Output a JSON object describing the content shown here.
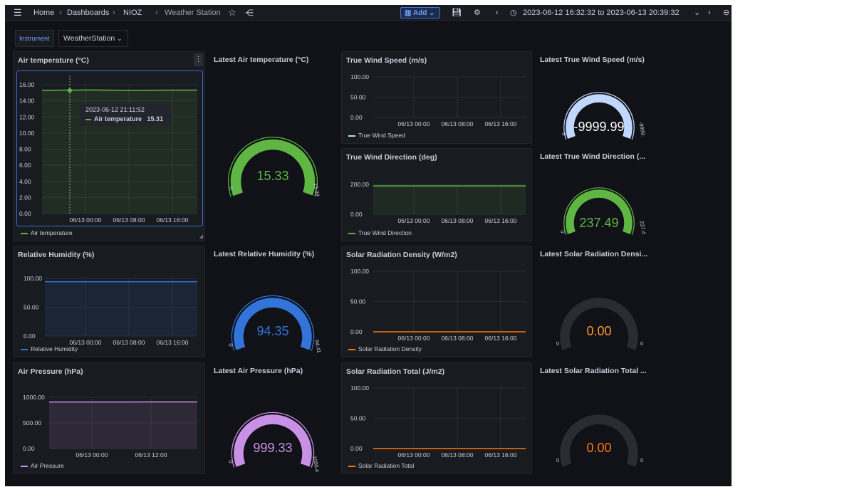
{
  "breadcrumb": {
    "home": "Home",
    "dashboards": "Dashboards",
    "folder": "NIOZ",
    "dashboard": "Weather Station"
  },
  "toolbar": {
    "add_label": "Add",
    "time_range": "2023-06-12 16:32:32 to 2023-06-13 20:39:32"
  },
  "variables": {
    "instrument_label": "Instrument",
    "instrument_value": "WeatherStation"
  },
  "colors": {
    "green": "#5fb643",
    "blue": "#3274d9",
    "purple": "#c891e6",
    "lightblue": "#c0d8ff",
    "orange": "#ff780a",
    "yellow": "#fade2a"
  },
  "panels": {
    "air_temp": {
      "title": "Air temperature (°C)",
      "yticks": [
        "16.00",
        "14.00",
        "12.00",
        "10.00",
        "8.00",
        "6.00",
        "4.00",
        "2.00",
        "0.00"
      ],
      "xticks": [
        "06/13 00:00",
        "06/13 08:00",
        "06/13 16:00"
      ],
      "legend": "Air temperature",
      "tooltip_time": "2023-06-12 21:11:52",
      "tooltip_series": "Air temperature",
      "tooltip_value": "15.31"
    },
    "latest_air_temp": {
      "title": "Latest Air temperature (°C)",
      "value": "15.33",
      "min": "0",
      "max": "15.39",
      "fraction": 0.996
    },
    "wind_speed": {
      "title": "True Wind Speed (m/s)",
      "yticks": [
        "100.00",
        "50.00",
        "0.00"
      ],
      "xticks": [
        "06/13 00:00",
        "06/13 08:00",
        "06/13 16:00"
      ],
      "legend": "True Wind Speed"
    },
    "latest_wind_speed": {
      "title": "Latest True Wind Speed (m/s)",
      "value": "-9999.99",
      "min": "0",
      "max": "-9999.",
      "fraction": 1.0
    },
    "wind_dir": {
      "title": "True Wind Direction (deg)",
      "yticks": [
        "200.00",
        "0.00"
      ],
      "xticks": [
        "06/13 00:00",
        "06/13 08:00",
        "06/13 16:00"
      ],
      "legend": "True Wind Direction"
    },
    "latest_wind_dir": {
      "title": "Latest True Wind Direction (...",
      "value": "237.49",
      "min": "0",
      "max": "237.4",
      "fraction": 1.0
    },
    "humidity": {
      "title": "Relative Humidity (%)",
      "yticks": [
        "100.00",
        "50.00",
        "0.00"
      ],
      "xticks": [
        "06/13 00:00",
        "06/13 08:00",
        "06/13 16:00"
      ],
      "legend": "Relative Humidity"
    },
    "latest_humidity": {
      "title": "Latest Relative Humidity (%)",
      "value": "94.35",
      "min": "0",
      "max": "94.41",
      "fraction": 0.999
    },
    "solar_density": {
      "title": "Solar Radiation Density (W/m2)",
      "yticks": [
        "100.00",
        "50.00",
        "0.00"
      ],
      "xticks": [
        "06/13 00:00",
        "06/13 08:00",
        "06/13 16:00"
      ],
      "legend": "Solar Radiation Density"
    },
    "latest_solar_density": {
      "title": "Latest Solar Radiation Densi...",
      "value": "0.00",
      "min": "0",
      "max": "0",
      "fraction": 0.0
    },
    "pressure": {
      "title": "Air Pressure (hPa)",
      "yticks": [
        "1000.00",
        "500.00",
        "0.00"
      ],
      "xticks": [
        "06/13 00:00",
        "06/13 12:00"
      ],
      "legend": "Air Pressure"
    },
    "latest_pressure": {
      "title": "Latest Air Pressure (hPa)",
      "value": "999.33",
      "min": "0",
      "max": "1000.4",
      "fraction": 0.999
    },
    "solar_total": {
      "title": "Solar Radiation Total (J/m2)",
      "yticks": [
        "100.00",
        "50.00",
        "0.00"
      ],
      "xticks": [
        "06/13 00:00",
        "06/13 08:00",
        "06/13 16:00"
      ],
      "legend": "Solar Radiation Total"
    },
    "latest_solar_total": {
      "title": "Latest Solar Radiation Total ...",
      "value": "0.00",
      "min": "0",
      "max": "0",
      "fraction": 0.0
    }
  }
}
